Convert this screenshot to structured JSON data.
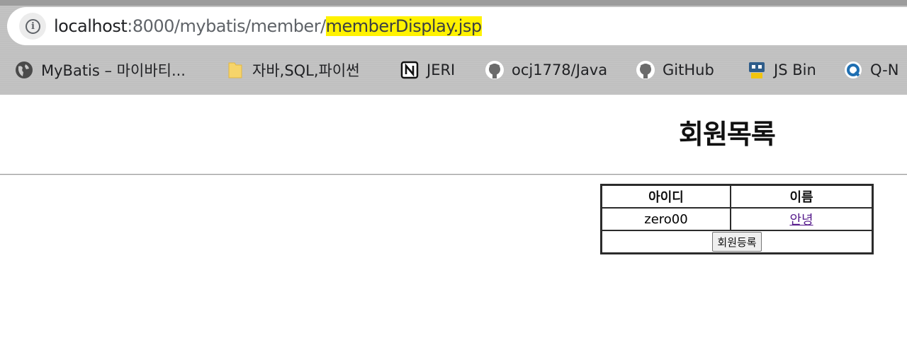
{
  "browser": {
    "url_host": "localhost",
    "url_path": ":8000/mybatis/member/",
    "url_highlight": "memberDisplay.jsp",
    "bookmarks": [
      {
        "label": "MyBatis – 마이바티...",
        "icon": "globe-icon"
      },
      {
        "label": "자바,SQL,파이썬",
        "icon": "folder-icon"
      },
      {
        "label": "JERI",
        "icon": "notion-icon"
      },
      {
        "label": "ocj1778/Java",
        "icon": "github-icon"
      },
      {
        "label": "GitHub",
        "icon": "github-icon"
      },
      {
        "label": "JS Bin",
        "icon": "jsbin-icon"
      },
      {
        "label": "Q-N",
        "icon": "q-icon"
      }
    ]
  },
  "page": {
    "title": "회원목록",
    "table": {
      "headers": [
        "아이디",
        "이름"
      ],
      "rows": [
        {
          "id": "zero00",
          "name": "안녕"
        }
      ]
    },
    "register_button": "회원등록"
  }
}
